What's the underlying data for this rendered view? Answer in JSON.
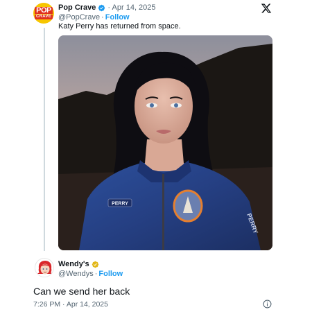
{
  "tweet": {
    "author_name": "Pop Crave",
    "author_verified": true,
    "date_prefix": "· Apr 14, 2025",
    "handle": "@PopCrave",
    "follow_label": "Follow",
    "separator": "·",
    "text": "Katy Perry has returned from space.",
    "avatar_logo_top": "POP",
    "avatar_logo_bottom": "CRAVE",
    "platform_icon": "x-logo-icon",
    "photo_patch_text": "PERRY",
    "photo_sleeve_text": "PERRY"
  },
  "reply": {
    "author_name": "Wendy's",
    "author_badge": "gold",
    "handle": "@Wendys",
    "separator": "·",
    "follow_label": "Follow",
    "text": "Can we send her back",
    "timestamp": "7:26 PM · Apr 14, 2025",
    "info_icon": "info-icon"
  },
  "colors": {
    "accent_blue": "#1d9bf0",
    "text_primary": "#0f1419",
    "text_secondary": "#536471",
    "verified_blue": "#1d9bf0",
    "verified_gold": "#e2b719",
    "popcrave_yellow": "#f7c600",
    "popcrave_red": "#e0311d"
  }
}
